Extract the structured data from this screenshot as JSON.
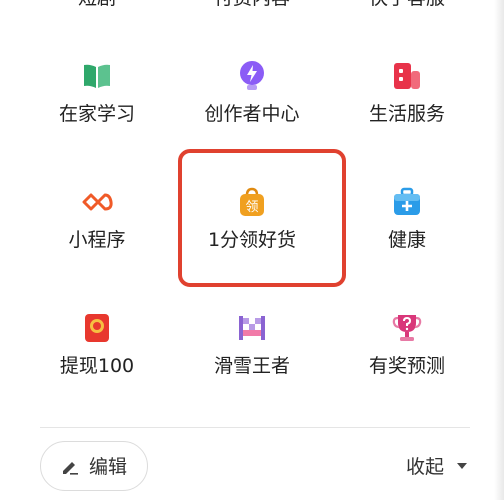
{
  "top_row_partial": [
    "短剧",
    "付费内容",
    "快手客服"
  ],
  "grid": [
    {
      "label": "在家学习",
      "icon": "open-book-icon",
      "color": "#2fa86b"
    },
    {
      "label": "创作者中心",
      "icon": "lightning-bulb-icon",
      "color": "#8b5cf6"
    },
    {
      "label": "生活服务",
      "icon": "shop-bags-icon",
      "color": "#e8334a"
    },
    {
      "label": "小程序",
      "icon": "mini-program-loop-icon",
      "color": "#f05a28"
    },
    {
      "label": "1分领好货",
      "icon": "shopping-bag-icon",
      "color": "#f0a020"
    },
    {
      "label": "健康",
      "icon": "medical-kit-icon",
      "color": "#2b9ce8"
    },
    {
      "label": "提现100",
      "icon": "red-envelope-icon",
      "color": "#e8382e"
    },
    {
      "label": "滑雪王者",
      "icon": "ski-flag-icon",
      "color": "#8a63d2"
    },
    {
      "label": "有奖预测",
      "icon": "trophy-question-icon",
      "color": "#d9377a"
    }
  ],
  "bag_glyph": "领",
  "footer": {
    "edit_label": "编辑",
    "collapse_label": "收起"
  },
  "highlight_color": "#e0412f"
}
